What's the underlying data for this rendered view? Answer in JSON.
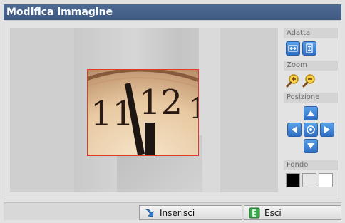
{
  "window": {
    "title": "Modifica immagine"
  },
  "panel": {
    "adatta": {
      "label": "Adatta",
      "buttons": [
        "fit-width-icon",
        "fit-height-icon"
      ]
    },
    "zoom": {
      "label": "Zoom",
      "buttons": [
        "zoom-in-icon",
        "zoom-out-icon"
      ]
    },
    "posizione": {
      "label": "Posizione",
      "buttons": [
        "arrow-up-icon",
        "arrow-left-icon",
        "center-icon",
        "arrow-right-icon",
        "arrow-down-icon"
      ]
    },
    "fondo": {
      "label": "Fondo",
      "colors": [
        "#000000",
        "#e6e6e6",
        "#ffffff"
      ]
    }
  },
  "footer": {
    "inserisci_label": "Inserisci",
    "esci_label": "Esci"
  },
  "image": {
    "clock_numerals": [
      "11",
      "12",
      "1"
    ]
  }
}
